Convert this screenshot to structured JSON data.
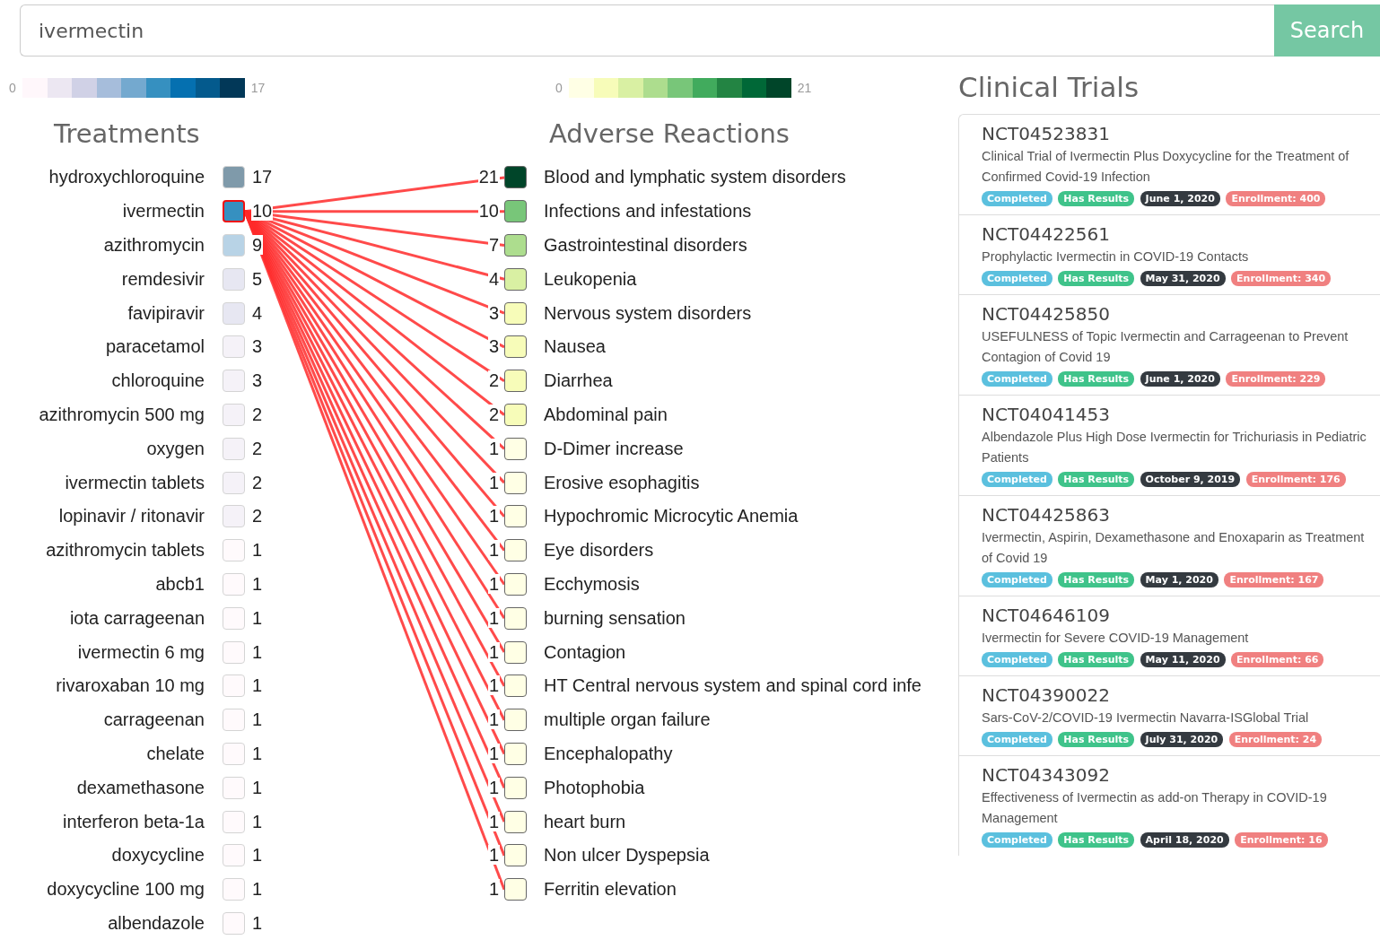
{
  "search": {
    "value": "ivermectin",
    "button": "Search"
  },
  "treatments": {
    "title": "Treatments",
    "scale_min": "0",
    "scale_max": "17",
    "items": [
      {
        "name": "hydroxychloroquine",
        "count": "17",
        "selected": false
      },
      {
        "name": "ivermectin",
        "count": "10",
        "selected": true
      },
      {
        "name": "azithromycin",
        "count": "9",
        "selected": false
      },
      {
        "name": "remdesivir",
        "count": "5",
        "selected": false
      },
      {
        "name": "favipiravir",
        "count": "4",
        "selected": false
      },
      {
        "name": "paracetamol",
        "count": "3",
        "selected": false
      },
      {
        "name": "chloroquine",
        "count": "3",
        "selected": false
      },
      {
        "name": "azithromycin 500 mg",
        "count": "2",
        "selected": false
      },
      {
        "name": "oxygen",
        "count": "2",
        "selected": false
      },
      {
        "name": "ivermectin tablets",
        "count": "2",
        "selected": false
      },
      {
        "name": "lopinavir / ritonavir",
        "count": "2",
        "selected": false
      },
      {
        "name": "azithromycin tablets",
        "count": "1",
        "selected": false
      },
      {
        "name": "abcb1",
        "count": "1",
        "selected": false
      },
      {
        "name": "iota carrageenan",
        "count": "1",
        "selected": false
      },
      {
        "name": "ivermectin 6 mg",
        "count": "1",
        "selected": false
      },
      {
        "name": "rivaroxaban 10 mg",
        "count": "1",
        "selected": false
      },
      {
        "name": "carrageenan",
        "count": "1",
        "selected": false
      },
      {
        "name": "chelate",
        "count": "1",
        "selected": false
      },
      {
        "name": "dexamethasone",
        "count": "1",
        "selected": false
      },
      {
        "name": "interferon beta-1a",
        "count": "1",
        "selected": false
      },
      {
        "name": "doxycycline",
        "count": "1",
        "selected": false
      },
      {
        "name": "doxycycline 100 mg",
        "count": "1",
        "selected": false
      },
      {
        "name": "albendazole",
        "count": "1",
        "selected": false
      }
    ]
  },
  "reactions": {
    "title": "Adverse Reactions",
    "scale_min": "0",
    "scale_max": "21",
    "items": [
      {
        "name": "Blood and lymphatic system disorders",
        "count": "21"
      },
      {
        "name": "Infections and infestations",
        "count": "10"
      },
      {
        "name": "Gastrointestinal disorders",
        "count": "7"
      },
      {
        "name": "Leukopenia",
        "count": "4"
      },
      {
        "name": "Nervous system disorders",
        "count": "3"
      },
      {
        "name": "Nausea",
        "count": "3"
      },
      {
        "name": "Diarrhea",
        "count": "2"
      },
      {
        "name": "Abdominal pain",
        "count": "2"
      },
      {
        "name": "D-Dimer increase",
        "count": "1"
      },
      {
        "name": "Erosive esophagitis",
        "count": "1"
      },
      {
        "name": "Hypochromic Microcytic Anemia",
        "count": "1"
      },
      {
        "name": "Eye disorders",
        "count": "1"
      },
      {
        "name": "Ecchymosis",
        "count": "1"
      },
      {
        "name": "burning sensation",
        "count": "1"
      },
      {
        "name": "Contagion",
        "count": "1"
      },
      {
        "name": "HT Central nervous system and spinal cord infe",
        "count": "1"
      },
      {
        "name": "multiple organ failure",
        "count": "1"
      },
      {
        "name": "Encephalopathy",
        "count": "1"
      },
      {
        "name": "Photophobia",
        "count": "1"
      },
      {
        "name": "heart burn",
        "count": "1"
      },
      {
        "name": "Non ulcer Dyspepsia",
        "count": "1"
      },
      {
        "name": "Ferritin elevation",
        "count": "1"
      }
    ]
  },
  "trials": {
    "title": "Clinical Trials",
    "items": [
      {
        "id": "NCT04523831",
        "title": "Clinical Trial of Ivermectin Plus Doxycycline for the Treatment of Confirmed Covid-19 Infection",
        "badges": [
          {
            "kind": "status",
            "text": "Completed"
          },
          {
            "kind": "results",
            "text": "Has Results"
          },
          {
            "kind": "date",
            "text": "June 1, 2020"
          },
          {
            "kind": "enrollment",
            "text": "Enrollment: 400"
          }
        ]
      },
      {
        "id": "NCT04422561",
        "title": "Prophylactic Ivermectin in COVID-19 Contacts",
        "badges": [
          {
            "kind": "status",
            "text": "Completed"
          },
          {
            "kind": "results",
            "text": "Has Results"
          },
          {
            "kind": "date",
            "text": "May 31, 2020"
          },
          {
            "kind": "enrollment",
            "text": "Enrollment: 340"
          }
        ]
      },
      {
        "id": "NCT04425850",
        "title": "USEFULNESS of Topic Ivermectin and Carrageenan to Prevent Contagion of Covid 19",
        "badges": [
          {
            "kind": "status",
            "text": "Completed"
          },
          {
            "kind": "results",
            "text": "Has Results"
          },
          {
            "kind": "date",
            "text": "June 1, 2020"
          },
          {
            "kind": "enrollment",
            "text": "Enrollment: 229"
          }
        ]
      },
      {
        "id": "NCT04041453",
        "title": "Albendazole Plus High Dose Ivermectin for Trichuriasis in Pediatric Patients",
        "badges": [
          {
            "kind": "status",
            "text": "Completed"
          },
          {
            "kind": "results",
            "text": "Has Results"
          },
          {
            "kind": "date",
            "text": "October 9, 2019"
          },
          {
            "kind": "enrollment",
            "text": "Enrollment: 176"
          }
        ]
      },
      {
        "id": "NCT04425863",
        "title": "Ivermectin, Aspirin, Dexamethasone and Enoxaparin as Treatment of Covid 19",
        "badges": [
          {
            "kind": "status",
            "text": "Completed"
          },
          {
            "kind": "results",
            "text": "Has Results"
          },
          {
            "kind": "date",
            "text": "May 1, 2020"
          },
          {
            "kind": "enrollment",
            "text": "Enrollment: 167"
          }
        ]
      },
      {
        "id": "NCT04646109",
        "title": "Ivermectin for Severe COVID-19 Management",
        "badges": [
          {
            "kind": "status",
            "text": "Completed"
          },
          {
            "kind": "results",
            "text": "Has Results"
          },
          {
            "kind": "date",
            "text": "May 11, 2020"
          },
          {
            "kind": "enrollment",
            "text": "Enrollment: 66"
          }
        ]
      },
      {
        "id": "NCT04390022",
        "title": "Sars-CoV-2/COVID-19 Ivermectin Navarra-ISGlobal Trial",
        "badges": [
          {
            "kind": "status",
            "text": "Completed"
          },
          {
            "kind": "results",
            "text": "Has Results"
          },
          {
            "kind": "date",
            "text": "July 31, 2020"
          },
          {
            "kind": "enrollment",
            "text": "Enrollment: 24"
          }
        ]
      },
      {
        "id": "NCT04343092",
        "title": "Effectiveness of Ivermectin as add-on Therapy in COVID-19 Management",
        "badges": [
          {
            "kind": "status",
            "text": "Completed"
          },
          {
            "kind": "results",
            "text": "Has Results"
          },
          {
            "kind": "date",
            "text": "April 18, 2020"
          },
          {
            "kind": "enrollment",
            "text": "Enrollment: 16"
          }
        ]
      }
    ]
  }
}
